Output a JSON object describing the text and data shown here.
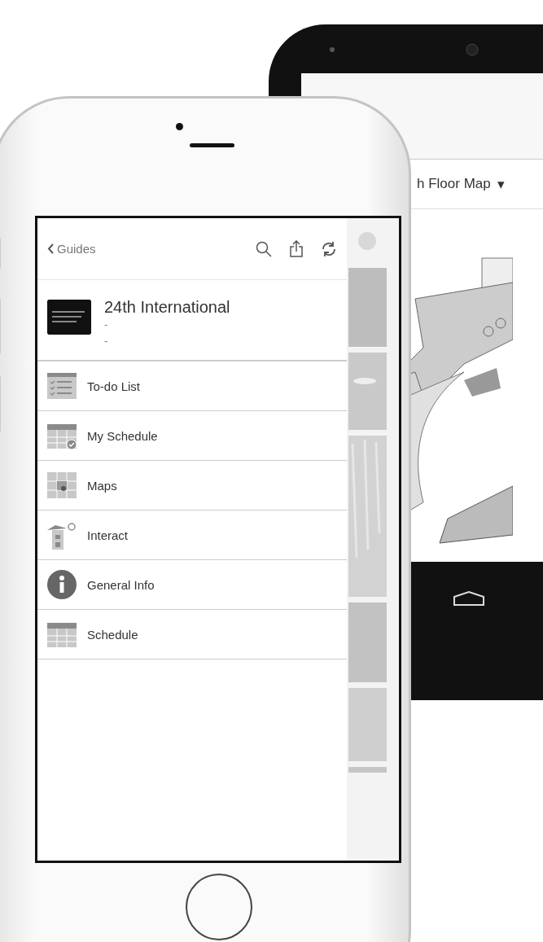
{
  "tablet": {
    "dropdown": {
      "label": "h Floor Map",
      "caret": "▾"
    }
  },
  "phone": {
    "nav": {
      "back_label": "Guides"
    },
    "event": {
      "title": "24th International",
      "line_1": "-",
      "line_2": "-"
    },
    "menu": [
      {
        "label": "To-do List",
        "kind": "todo"
      },
      {
        "label": "My Schedule",
        "kind": "my_schedule"
      },
      {
        "label": "Maps",
        "kind": "maps"
      },
      {
        "label": "Interact",
        "kind": "interact"
      },
      {
        "label": "General Info",
        "kind": "info"
      },
      {
        "label": "Schedule",
        "kind": "schedule"
      }
    ]
  }
}
